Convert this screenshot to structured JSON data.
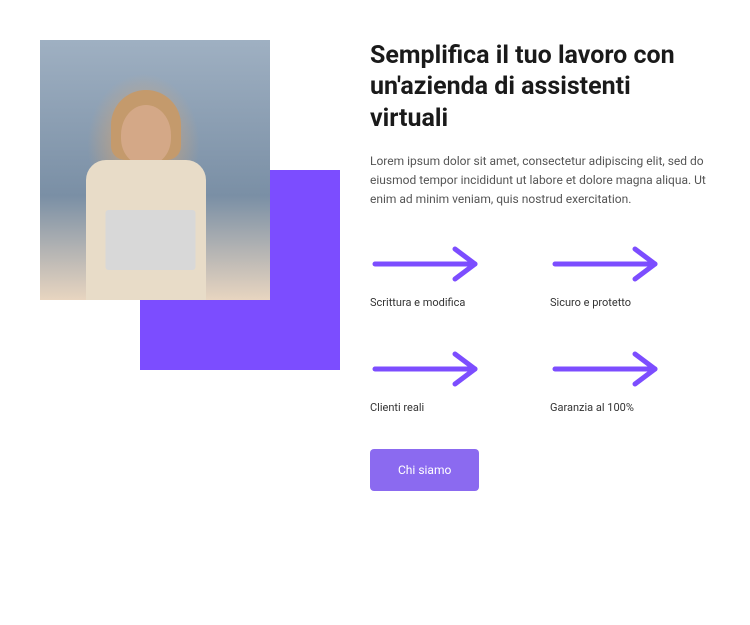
{
  "heading": "Semplifica il tuo lavoro con un'azienda di assistenti virtuali",
  "description": "Lorem ipsum dolor sit amet, consectetur adipiscing elit, sed do eiusmod tempor incididunt ut labore et dolore magna aliqua. Ut enim ad minim veniam, quis nostrud exercitation.",
  "features": [
    {
      "label": "Scrittura e modifica"
    },
    {
      "label": "Sicuro e protetto"
    },
    {
      "label": "Clienti reali"
    },
    {
      "label": "Garanzia al 100%"
    }
  ],
  "cta_label": "Chi siamo",
  "colors": {
    "accent": "#7c4dff",
    "button": "#8b6af0"
  }
}
